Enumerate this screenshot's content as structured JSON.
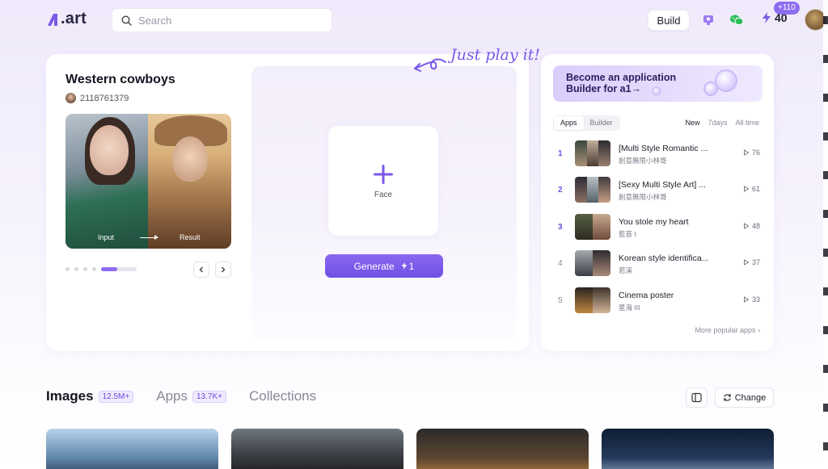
{
  "header": {
    "logo_text": ".art",
    "search_placeholder": "Search",
    "build_label": "Build",
    "credits": "40",
    "credits_badge": "+110"
  },
  "feature_card": {
    "title": "Western cowboys",
    "author_id": "2118761379",
    "input_label": "Input",
    "result_label": "Result",
    "upload_label": "Face",
    "generate_label": "Generate",
    "generate_cost": "1",
    "carousel_progress": 0.45
  },
  "tagline": "Just play it!",
  "side_card": {
    "promo_text": "Become an application Builder for a1→",
    "tabs": [
      "Apps",
      "Builder"
    ],
    "filters": [
      "New",
      "7days",
      "All time"
    ],
    "more_label": "More popular apps",
    "rank_items": [
      {
        "rank": "1",
        "title": "[Multi Style Romantic ...",
        "author": "創意無限小林哥",
        "plays": "76"
      },
      {
        "rank": "2",
        "title": "[Sexy Multi Style Art] ...",
        "author": "創意無限小林哥",
        "plays": "61"
      },
      {
        "rank": "3",
        "title": "You stole my heart",
        "author": "藍苔 I",
        "plays": "48"
      },
      {
        "rank": "4",
        "title": "Korean style identifica...",
        "author": "若溪",
        "plays": "37"
      },
      {
        "rank": "5",
        "title": "Cinema poster",
        "author": "星海 III",
        "plays": "33"
      }
    ]
  },
  "section": {
    "tabs": [
      {
        "label": "Images",
        "count": "12.5M+"
      },
      {
        "label": "Apps",
        "count": "13.7K+"
      },
      {
        "label": "Collections",
        "count": ""
      }
    ],
    "change_label": "Change"
  },
  "colors": {
    "accent": "#7a58e8",
    "accent_light": "#efeafd",
    "text": "#1d1d29"
  }
}
